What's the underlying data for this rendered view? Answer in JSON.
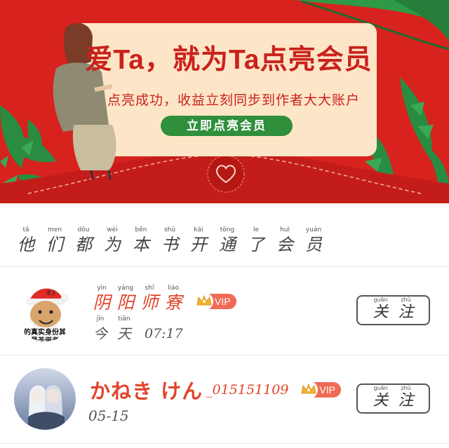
{
  "banner": {
    "headline": "爱Ta，就为Ta点亮会员",
    "subline": "点亮成功，收益立刻同步到作者大大账户",
    "cta_label": "立即点亮会员"
  },
  "section": {
    "title_chars": [
      {
        "py": "tā",
        "hz": "他"
      },
      {
        "py": "men",
        "hz": "们"
      },
      {
        "py": "dōu",
        "hz": "都"
      },
      {
        "py": "wèi",
        "hz": "为"
      },
      {
        "py": "běn",
        "hz": "本"
      },
      {
        "py": "shū",
        "hz": "书"
      },
      {
        "py": "kāi",
        "hz": "开"
      },
      {
        "py": "tōng",
        "hz": "通"
      },
      {
        "py": "le",
        "hz": "了"
      },
      {
        "py": "huì",
        "hz": "会"
      },
      {
        "py": "yuán",
        "hz": "员"
      }
    ]
  },
  "members": [
    {
      "name_chars": [
        {
          "py": "yīn",
          "hz": "阴"
        },
        {
          "py": "yáng",
          "hz": "阳"
        },
        {
          "py": "shī",
          "hz": "师"
        },
        {
          "py": "liáo",
          "hz": "寮"
        }
      ],
      "vip": "VIP",
      "time_chars": [
        {
          "py": "jīn",
          "hz": "今"
        },
        {
          "py": "tiān",
          "hz": "天"
        }
      ],
      "time": "07:17",
      "avatar_caption_1": "的真实身份其",
      "avatar_caption_2": "是圣诞老",
      "avatar_hat_label": "老王",
      "follow_chars": [
        {
          "py": "guān",
          "hz": "关"
        },
        {
          "py": "zhù",
          "hz": "注"
        }
      ]
    },
    {
      "name": "かねき けん",
      "name_suffix": "_015151109",
      "vip": "VIP",
      "date": "05-15",
      "follow_chars": [
        {
          "py": "guān",
          "hz": "关"
        },
        {
          "py": "zhù",
          "hz": "注"
        }
      ]
    }
  ],
  "colors": {
    "banner_red": "#d7221d",
    "card_cream": "#fde6c7",
    "cta_green": "#2f8f3b",
    "name_orange": "#e0452a",
    "vip_red": "#f06a55"
  }
}
